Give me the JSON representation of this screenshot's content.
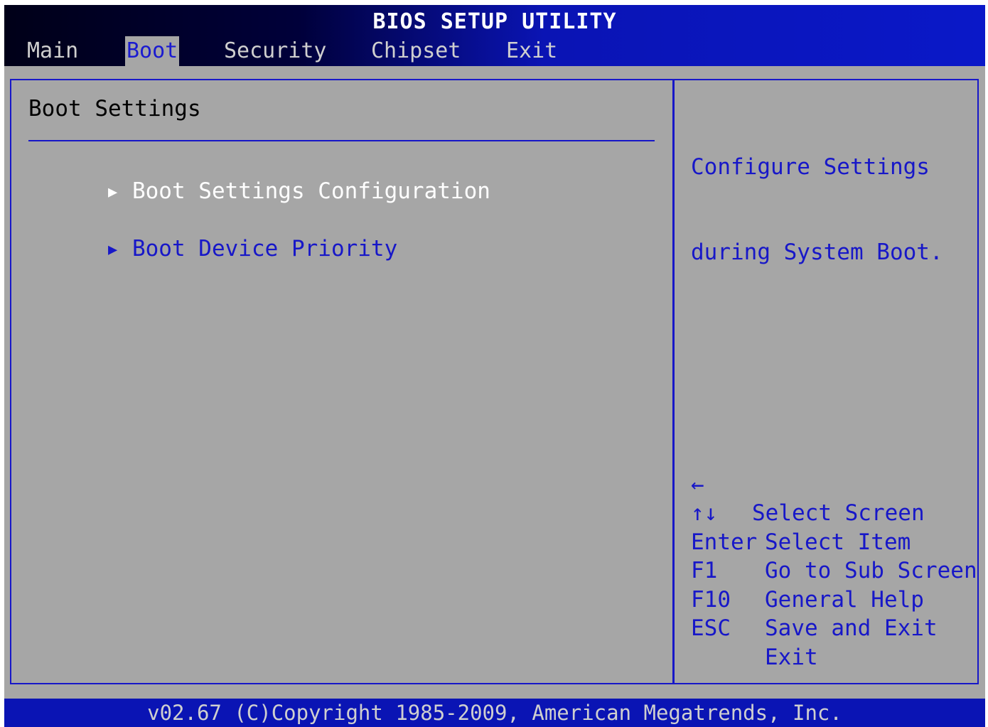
{
  "title": "BIOS SETUP UTILITY",
  "tabs": [
    {
      "label": "Main"
    },
    {
      "label": "Boot"
    },
    {
      "label": "Security"
    },
    {
      "label": "Chipset"
    },
    {
      "label": "Exit"
    }
  ],
  "active_tab": "Boot",
  "main": {
    "section_title": "Boot Settings",
    "items": [
      {
        "label": "Boot Settings Configuration",
        "selected": true
      },
      {
        "label": "Boot Device Priority",
        "selected": false
      }
    ]
  },
  "help": {
    "line1": "Configure Settings",
    "line2": "during System Boot."
  },
  "keys": [
    {
      "key": "←",
      "desc": "Select Screen"
    },
    {
      "key": "↑↓",
      "desc": "Select Item"
    },
    {
      "key": "Enter",
      "desc": "Go to Sub Screen"
    },
    {
      "key": "F1",
      "desc": "General Help"
    },
    {
      "key": "F10",
      "desc": "Save and Exit"
    },
    {
      "key": "ESC",
      "desc": "Exit"
    }
  ],
  "footer": "v02.67 (C)Copyright 1985-2009, American Megatrends, Inc.",
  "colors": {
    "background": "#a6a6a6",
    "accent_blue": "#1717c8",
    "highlight_text": "#ffffff",
    "title_bar": "#0a14b4"
  }
}
